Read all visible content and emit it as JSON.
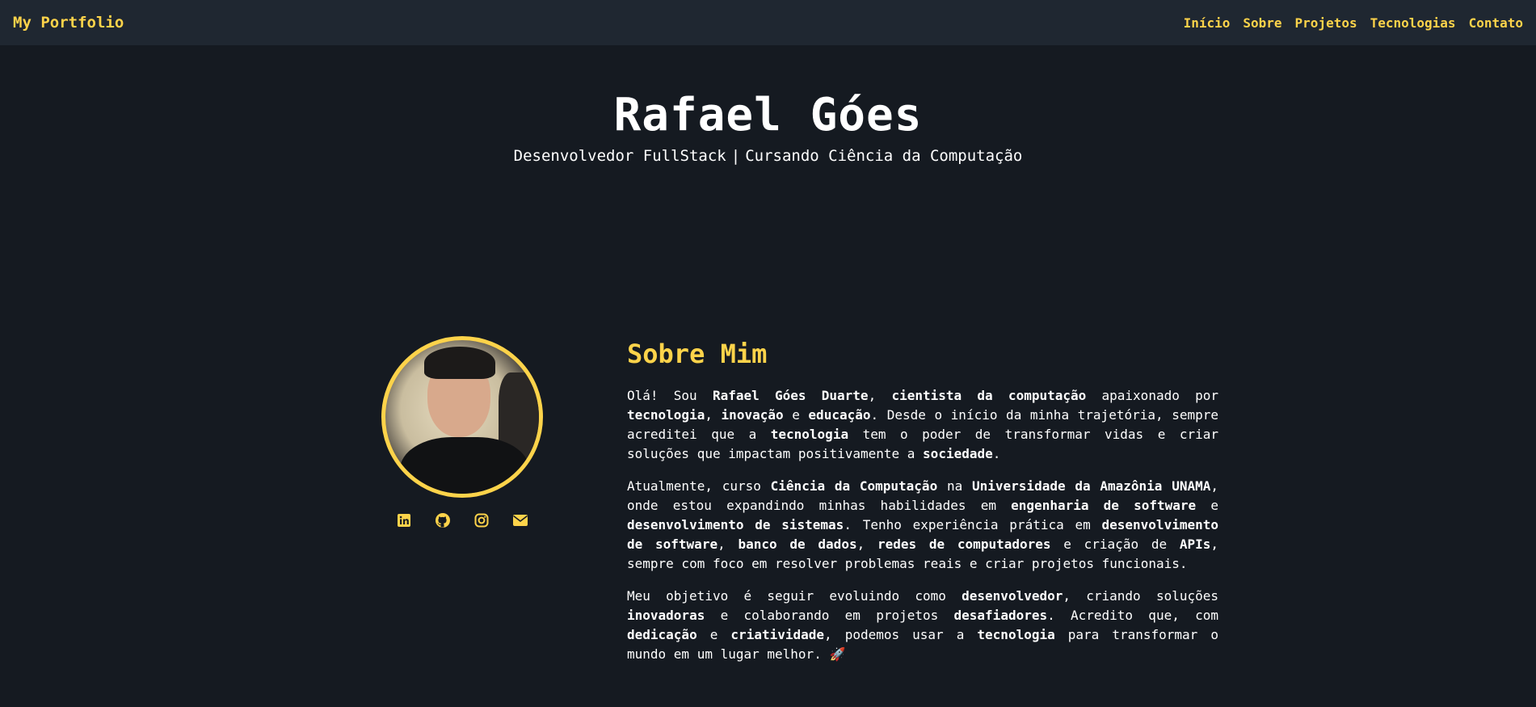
{
  "nav": {
    "brand": "My Portfolio",
    "links": [
      "Início",
      "Sobre",
      "Projetos",
      "Tecnologias",
      "Contato"
    ]
  },
  "hero": {
    "name": "Rafael Góes",
    "role": "Desenvolvedor FullStack",
    "separator": "|",
    "course": "Cursando Ciência da Computação"
  },
  "about": {
    "title": "Sobre Mim",
    "paragraphs": [
      [
        {
          "t": "Olá! Sou "
        },
        {
          "t": "Rafael Góes Duarte",
          "b": true
        },
        {
          "t": ", "
        },
        {
          "t": "cientista da computação",
          "b": true
        },
        {
          "t": " apaixonado por "
        },
        {
          "t": "tecnologia",
          "b": true
        },
        {
          "t": ", "
        },
        {
          "t": "inovação",
          "b": true
        },
        {
          "t": " e "
        },
        {
          "t": "educação",
          "b": true
        },
        {
          "t": ". Desde o início da minha trajetória, sempre acreditei que a "
        },
        {
          "t": "tecnologia",
          "b": true
        },
        {
          "t": " tem o poder de transformar vidas e criar soluções que impactam positivamente a "
        },
        {
          "t": "sociedade",
          "b": true
        },
        {
          "t": "."
        }
      ],
      [
        {
          "t": "Atualmente, curso "
        },
        {
          "t": "Ciência da Computação",
          "b": true
        },
        {
          "t": " na "
        },
        {
          "t": "Universidade da Amazônia UNAMA",
          "b": true
        },
        {
          "t": ", onde estou expandindo minhas habilidades em "
        },
        {
          "t": "engenharia de software",
          "b": true
        },
        {
          "t": " e "
        },
        {
          "t": "desenvolvimento de sistemas",
          "b": true
        },
        {
          "t": ". Tenho experiência prática em "
        },
        {
          "t": "desenvolvimento de software",
          "b": true
        },
        {
          "t": ", "
        },
        {
          "t": "banco de dados",
          "b": true
        },
        {
          "t": ", "
        },
        {
          "t": "redes de computadores",
          "b": true
        },
        {
          "t": " e criação de "
        },
        {
          "t": "APIs",
          "b": true
        },
        {
          "t": ", sempre com foco em resolver problemas reais e criar projetos funcionais."
        }
      ],
      [
        {
          "t": "Meu objetivo é seguir evoluindo como "
        },
        {
          "t": "desenvolvedor",
          "b": true
        },
        {
          "t": ", criando soluções "
        },
        {
          "t": "inovadoras",
          "b": true
        },
        {
          "t": " e colaborando em projetos "
        },
        {
          "t": "desafiadores",
          "b": true
        },
        {
          "t": ". Acredito que, com "
        },
        {
          "t": "dedicação",
          "b": true
        },
        {
          "t": " e "
        },
        {
          "t": "criatividade",
          "b": true
        },
        {
          "t": ", podemos usar a "
        },
        {
          "t": "tecnologia",
          "b": true
        },
        {
          "t": " para transformar o mundo em um lugar melhor. 🚀"
        }
      ]
    ]
  },
  "socials": [
    {
      "icon": "linkedin-icon"
    },
    {
      "icon": "github-icon"
    },
    {
      "icon": "instagram-icon"
    },
    {
      "icon": "email-icon"
    }
  ],
  "colors": {
    "accent": "#fdd34a",
    "background": "#151a21",
    "navbar": "#1f2731",
    "text": "#ffffff"
  }
}
